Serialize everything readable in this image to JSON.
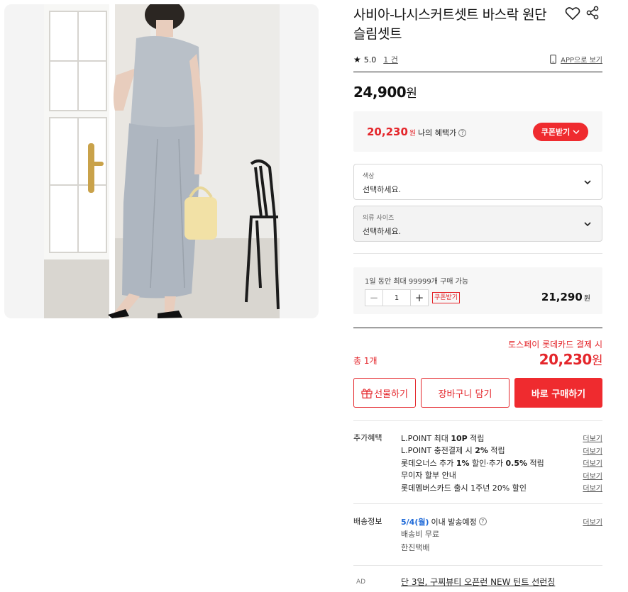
{
  "product": {
    "title": "사비아-나시스커트셋트 바스락 원단 슬림셋트",
    "rating": "5.0",
    "review_count": "1 건",
    "app_view": "APP으로 보기",
    "price": "24,900",
    "price_unit": "원"
  },
  "benefit": {
    "price": "20,230",
    "unit": "원",
    "label": "나의 혜택가",
    "coupon_button": "쿠폰받기"
  },
  "options": [
    {
      "label": "색상",
      "value": "선택하세요.",
      "disabled": false
    },
    {
      "label": "의류 사이즈",
      "value": "선택하세요.",
      "disabled": true
    }
  ],
  "quantity": {
    "note": "1일 동안 최대 99999개 구매 가능",
    "value": "1",
    "minus": "−",
    "plus": "+",
    "coupon_tag": "쿠폰받기",
    "price": "21,290",
    "unit": "원"
  },
  "total": {
    "promo": "토스페이 롯데카드 결제 시",
    "label": "총 1개",
    "price": "20,230",
    "unit": "원"
  },
  "buttons": {
    "gift": "선물하기",
    "cart": "장바구니 담기",
    "buy": "바로 구매하기"
  },
  "extra_benefits": {
    "title": "추가혜택",
    "more": "더보기",
    "items": [
      {
        "pre": "L.POINT 최대 ",
        "bold": "10P",
        "post": " 적립"
      },
      {
        "pre": "L.POINT 충전결제 시 ",
        "bold": "2%",
        "post": " 적립"
      },
      {
        "pre": "롯데오너스 추가 ",
        "bold": "1%",
        "post": " 할인·추가 ",
        "bold2": "0.5%",
        "post2": " 적립"
      },
      {
        "pre": "무이자 할부 안내",
        "bold": "",
        "post": ""
      },
      {
        "pre": "롯데멤버스카드 출시 1주년 20% 할인",
        "bold": "",
        "post": ""
      }
    ]
  },
  "shipping": {
    "title": "배송정보",
    "date": "5/4(월)",
    "date_suffix": "이내 발송예정",
    "fee": "배송비 무료",
    "carrier": "한진택배",
    "more": "더보기"
  },
  "ad": {
    "label": "AD",
    "text": "단 3일, 구찌뷰티 오픈런 NEW 틴트 선런칭"
  },
  "colors": {
    "accent": "#ef2b2f",
    "date_blue": "#1f6ad8"
  }
}
